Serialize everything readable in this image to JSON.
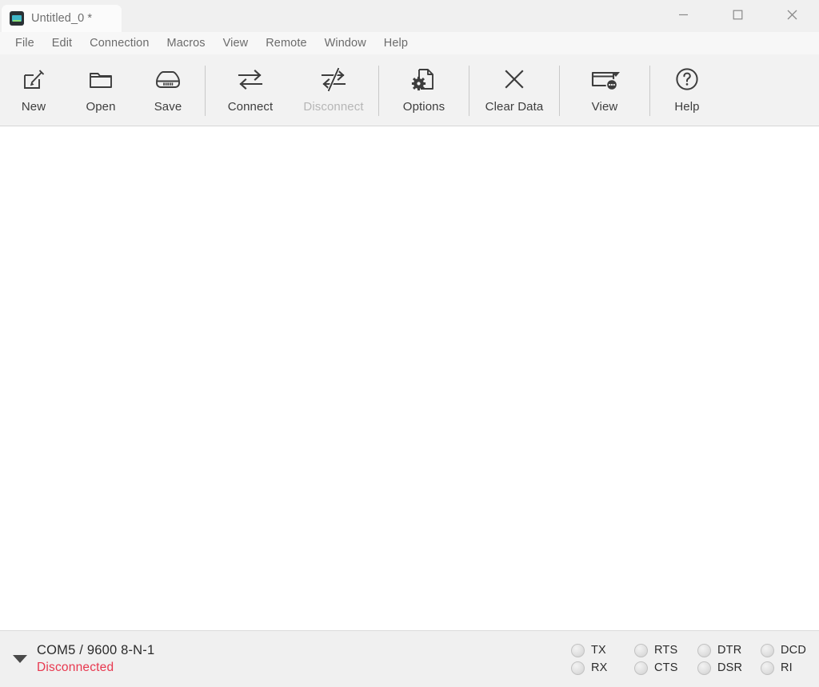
{
  "window": {
    "tab_title": "Untitled_0 *",
    "app_icon": "terminal-app-icon",
    "controls": {
      "minimize": "minimize-icon",
      "maximize": "maximize-icon",
      "close": "close-icon"
    }
  },
  "menubar": {
    "items": [
      {
        "label": "File"
      },
      {
        "label": "Edit"
      },
      {
        "label": "Connection"
      },
      {
        "label": "Macros"
      },
      {
        "label": "View"
      },
      {
        "label": "Remote"
      },
      {
        "label": "Window"
      },
      {
        "label": "Help"
      }
    ]
  },
  "toolbar": {
    "groups": [
      {
        "buttons": [
          {
            "label": "New",
            "icon": "new-document-icon",
            "enabled": true
          },
          {
            "label": "Open",
            "icon": "folder-open-icon",
            "enabled": true
          },
          {
            "label": "Save",
            "icon": "save-disk-icon",
            "enabled": true
          }
        ]
      },
      {
        "buttons": [
          {
            "label": "Connect",
            "icon": "connect-arrows-icon",
            "enabled": true
          },
          {
            "label": "Disconnect",
            "icon": "disconnect-arrows-icon",
            "enabled": false
          }
        ]
      },
      {
        "buttons": [
          {
            "label": "Options",
            "icon": "document-gear-icon",
            "enabled": true
          }
        ]
      },
      {
        "buttons": [
          {
            "label": "Clear Data",
            "icon": "clear-x-icon",
            "enabled": true
          }
        ]
      },
      {
        "buttons": [
          {
            "label": "View",
            "icon": "view-window-icon",
            "enabled": true,
            "has_dropdown": true
          }
        ]
      },
      {
        "buttons": [
          {
            "label": "Help",
            "icon": "help-question-icon",
            "enabled": true
          }
        ]
      }
    ]
  },
  "terminal": {
    "content": ""
  },
  "statusbar": {
    "expander_icon": "caret-down-icon",
    "port_info": "COM5 / 9600 8-N-1",
    "connection_state": "Disconnected",
    "connection_state_color": "#e8384f",
    "led_columns": [
      {
        "top": {
          "label": "TX",
          "on": false
        },
        "bottom": {
          "label": "RX",
          "on": false
        }
      },
      {
        "top": {
          "label": "RTS",
          "on": false
        },
        "bottom": {
          "label": "CTS",
          "on": false
        }
      },
      {
        "top": {
          "label": "DTR",
          "on": false
        },
        "bottom": {
          "label": "DSR",
          "on": false
        }
      },
      {
        "top": {
          "label": "DCD",
          "on": false
        },
        "bottom": {
          "label": "RI",
          "on": false
        }
      }
    ]
  },
  "colors": {
    "titlebar_bg": "#f0f0f0",
    "tab_bg": "#fbfbfb",
    "menubar_bg": "#f7f7f7",
    "toolbar_bg": "#f2f2f2",
    "terminal_bg": "#ffffff",
    "statusbar_bg": "#f0f0f0",
    "icon_stroke": "#3d3d3d",
    "disabled_text": "#b6b6b6"
  }
}
